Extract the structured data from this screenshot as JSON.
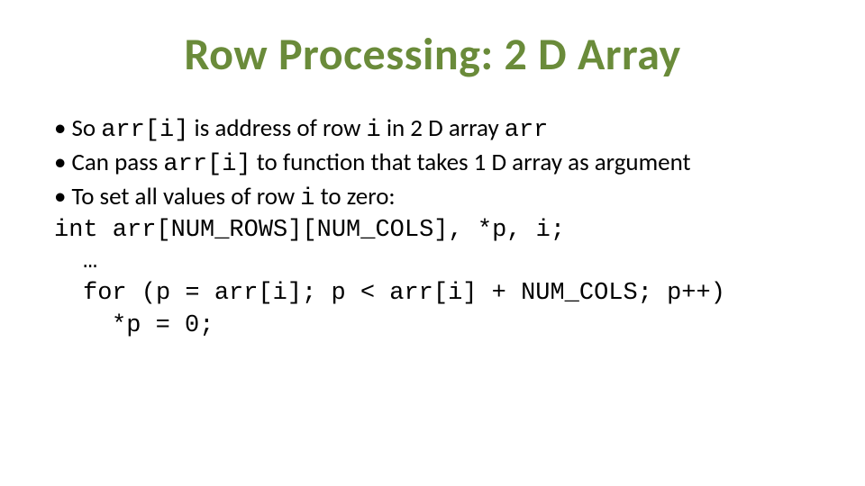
{
  "title": "Row Processing: 2 D Array",
  "bullets": {
    "b1": {
      "t1": "So ",
      "c1": "arr[i]",
      "t2": " is address of row ",
      "c2": "i",
      "t3": " in 2 D array ",
      "c3": "arr"
    },
    "b2": {
      "t1": "Can pass ",
      "c1": "arr[i]",
      "t2": " to function that takes 1 D array as argument"
    },
    "b3": {
      "t1": "To set all values of row ",
      "c1": "i",
      "t2": " to zero:"
    }
  },
  "code": {
    "l1": "int arr[NUM_ROWS][NUM_COLS], *p, i;",
    "l2": "…",
    "l3": "for (p = arr[i]; p < arr[i] + NUM_COLS; p++)",
    "l4": "*p = 0;"
  },
  "dot": "•"
}
